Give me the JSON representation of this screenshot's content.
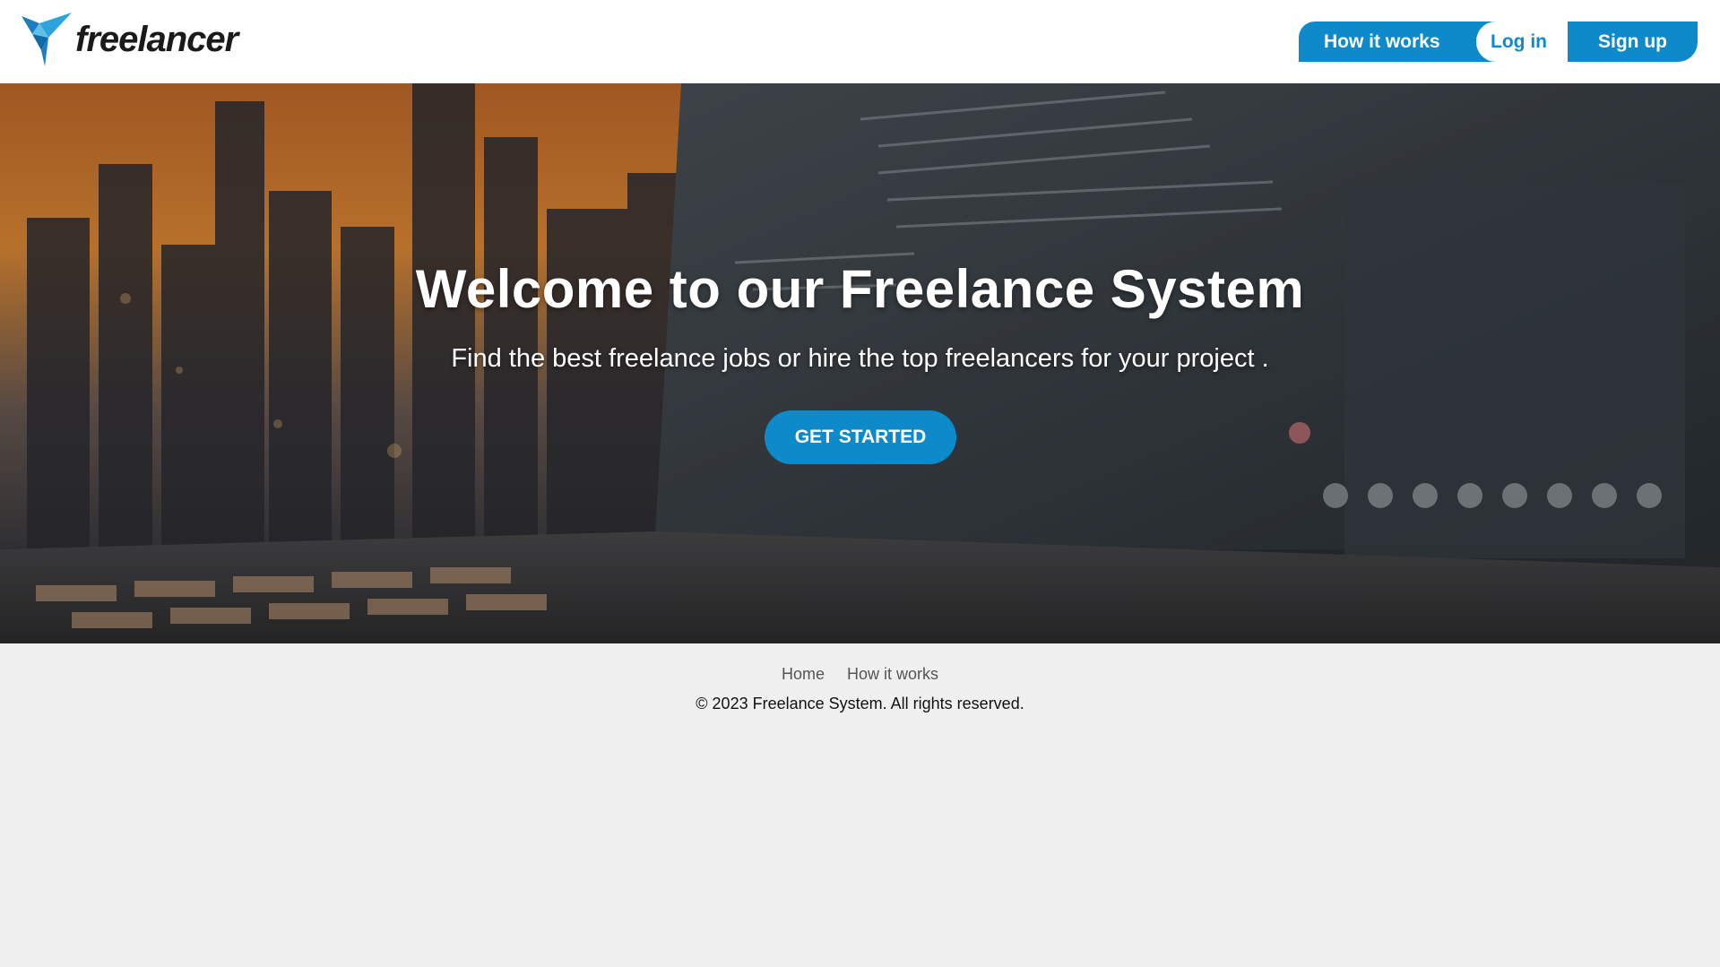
{
  "brand": {
    "name": "freelancer",
    "accent_color": "#0e8acb",
    "logo_icon": "bird-logo-icon"
  },
  "nav": {
    "how_it_works": "How it works",
    "login": "Log in",
    "signup": "Sign up"
  },
  "hero": {
    "title": "Welcome to our Freelance System",
    "subtitle": "Find the best freelance jobs or hire the top freelancers for your project .",
    "cta": "GET STARTED",
    "background_image": "laptop-city-sunset-photo"
  },
  "footer": {
    "links": [
      "Home",
      "How it works"
    ],
    "copyright": "© 2023 Freelance System. All rights reserved."
  }
}
